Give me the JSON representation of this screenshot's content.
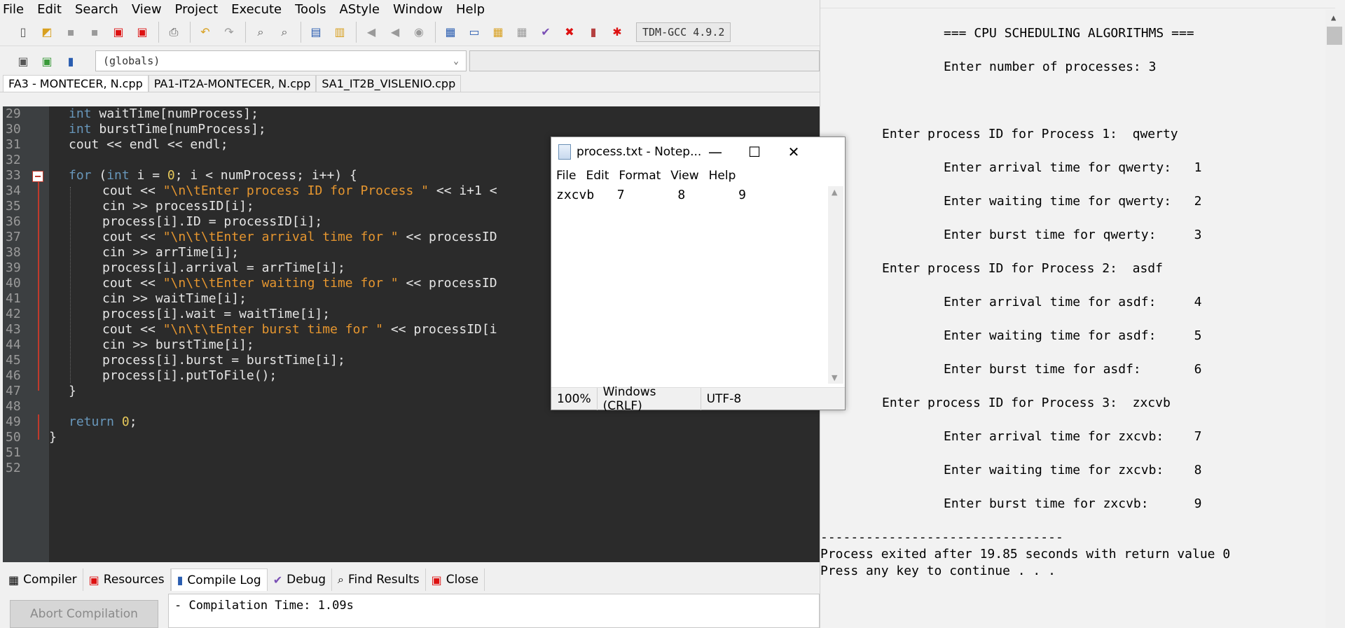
{
  "ide": {
    "menu": [
      "File",
      "Edit",
      "Search",
      "View",
      "Project",
      "Execute",
      "Tools",
      "AStyle",
      "Window",
      "Help"
    ],
    "compiler": "TDM-GCC 4.9.2",
    "globals": "(globals)",
    "tabs": [
      "FA3 - MONTECER, N.cpp",
      "PA1-IT2A-MONTECER, N.cpp",
      "SA1_IT2B_VISLENIO.cpp"
    ],
    "line_numbers": [
      "29",
      "30",
      "31",
      "32",
      "33",
      "34",
      "35",
      "36",
      "37",
      "38",
      "39",
      "40",
      "41",
      "42",
      "43",
      "44",
      "45",
      "46",
      "47",
      "48",
      "49",
      "50",
      "51",
      "52"
    ],
    "code": {
      "l29_type": "int",
      "l29_rest": " waitTime[numProcess];",
      "l30_type": "int",
      "l30_rest": " burstTime[numProcess];",
      "l31": "cout << endl << endl;",
      "l33_kw": "for",
      "l33_a": " (",
      "l33_type": "int",
      "l33_b": " i = ",
      "l33_num": "0",
      "l33_c": "; i < numProcess; i++) {",
      "l34_a": "cout << ",
      "l34_str": "\"\\n\\tEnter process ID for Process \"",
      "l34_b": " << i+1 <",
      "l35": "cin >> processID[i];",
      "l36": "process[i].ID = processID[i];",
      "l37_a": "cout << ",
      "l37_str": "\"\\n\\t\\tEnter arrival time for \"",
      "l37_b": " << processID",
      "l38": "cin >> arrTime[i];",
      "l39": "process[i].arrival = arrTime[i];",
      "l40_a": "cout << ",
      "l40_str": "\"\\n\\t\\tEnter waiting time for \"",
      "l40_b": " << processID",
      "l41": "cin >> waitTime[i];",
      "l42": "process[i].wait = waitTime[i];",
      "l43_a": "cout << ",
      "l43_str": "\"\\n\\t\\tEnter burst time for \"",
      "l43_b": " << processID[i",
      "l44": "cin >> burstTime[i];",
      "l45": "process[i].burst = burstTime[i];",
      "l46": "process[i].putToFile();",
      "l47": "}",
      "l49_kw": "return",
      "l49_sp": " ",
      "l49_num": "0",
      "l49_end": ";",
      "l50": "}"
    },
    "bottom_tabs": [
      "Compiler",
      "Resources",
      "Compile Log",
      "Debug",
      "Find Results",
      "Close"
    ],
    "abort_button": "Abort Compilation",
    "compile_log": "- Compilation Time: 1.09s"
  },
  "notepad": {
    "title": "process.txt - Notep...",
    "menu": [
      "File",
      "Edit",
      "Format",
      "View",
      "Help"
    ],
    "content": "zxcvb   7       8       9",
    "status": {
      "zoom": "100%",
      "line_ending": "Windows (CRLF)",
      "encoding": "UTF-8"
    }
  },
  "console": {
    "lines": [
      "=== CPU SCHEDULING ALGORITHMS ===",
      "Enter number of processes: 3",
      "Enter process ID for Process 1:  qwerty",
      "Enter arrival time for qwerty:   1",
      "Enter waiting time for qwerty:   2",
      "Enter burst time for qwerty:     3",
      "Enter process ID for Process 2:  asdf",
      "Enter arrival time for asdf:     4",
      "Enter waiting time for asdf:     5",
      "Enter burst time for asdf:       6",
      "Enter process ID for Process 3:  zxcvb",
      "Enter arrival time for zxcvb:    7",
      "Enter waiting time for zxcvb:    8",
      "Enter burst time for zxcvb:      9",
      "--------------------------------",
      "Process exited after 19.85 seconds with return value 0",
      "Press any key to continue . . ."
    ]
  }
}
